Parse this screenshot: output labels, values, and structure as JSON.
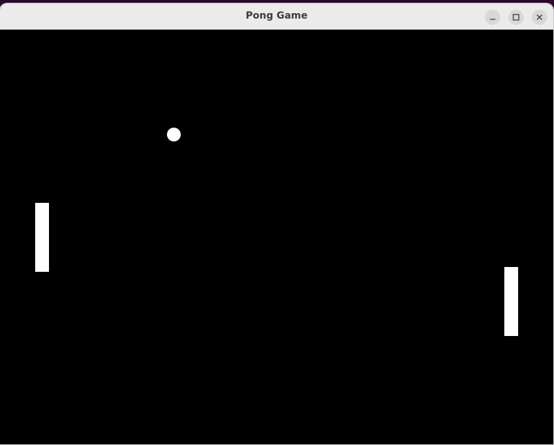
{
  "window": {
    "title": "Pong Game",
    "controls": {
      "minimize_icon": "minimize-icon",
      "maximize_icon": "maximize-icon",
      "close_icon": "close-icon"
    }
  },
  "game": {
    "background_color": "#000000",
    "object_color": "#ffffff"
  }
}
